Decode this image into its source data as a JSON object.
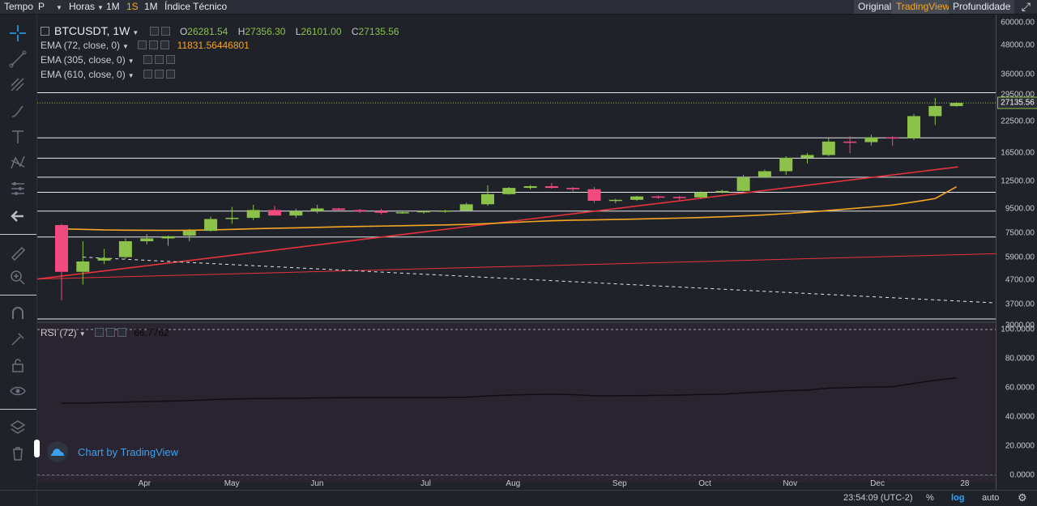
{
  "toolbar": {
    "tempo": "Tempo",
    "period": "P",
    "horas": "Horas",
    "tf_1m_a": "1M",
    "tf_1s": "1S",
    "tf_1m_b": "1M",
    "indicator": "Índice Técnico"
  },
  "views": {
    "original": "Original",
    "tradingview": "TradingView",
    "depth": "Profundidade"
  },
  "legend": {
    "symbol": "BTCUSDT, 1W",
    "o_label": "O",
    "o_value": "26281.54",
    "h_label": "H",
    "h_value": "27356.30",
    "l_label": "L",
    "l_value": "26101.00",
    "c_label": "C",
    "c_value": "27135.56",
    "ema1": "EMA (72, close, 0)",
    "ema1_value": "11831.56446801",
    "ema2": "EMA (305, close, 0)",
    "ema3": "EMA (610, close, 0)",
    "rsi": "RSI (72)",
    "rsi_value": "66.7762"
  },
  "price_axis": [
    "60000.00",
    "48000.00",
    "36000.00",
    "29500.00",
    "22500.00",
    "16500.00",
    "12500.00",
    "9500.00",
    "7500.00",
    "5900.00",
    "4700.00",
    "3700.00",
    "3000.00"
  ],
  "last_price": "27135.56",
  "rsi_axis": [
    "100.0000",
    "80.0000",
    "60.0000",
    "40.0000",
    "20.0000",
    "0.0000"
  ],
  "time_axis": [
    "Apr",
    "May",
    "Jun",
    "Jul",
    "Aug",
    "Sep",
    "Oct",
    "Nov",
    "Dec",
    "28"
  ],
  "status": {
    "time": "23:54:09 (UTC-2)",
    "percent": "%",
    "log": "log",
    "auto": "auto"
  },
  "watermark": "Chart by TradingView",
  "colors": {
    "up": "#8cc14a",
    "down": "#f04a7f",
    "ema_orange": "#f5a623",
    "accent": "#2aa6ff",
    "trend_red": "#e8323c"
  },
  "chart_data": {
    "type": "candlestick",
    "scale": "log",
    "ylim": [
      3000,
      60000
    ],
    "candles": [
      {
        "o": 8100,
        "h": 8200,
        "l": 3850,
        "c": 5100
      },
      {
        "o": 5100,
        "h": 6900,
        "l": 4500,
        "c": 5650
      },
      {
        "o": 5700,
        "h": 6400,
        "l": 5500,
        "c": 5850
      },
      {
        "o": 5900,
        "h": 7100,
        "l": 5800,
        "c": 6900
      },
      {
        "o": 6900,
        "h": 7400,
        "l": 6700,
        "c": 7100
      },
      {
        "o": 7100,
        "h": 7300,
        "l": 6600,
        "c": 7250
      },
      {
        "o": 7300,
        "h": 7800,
        "l": 6900,
        "c": 7650
      },
      {
        "o": 7650,
        "h": 8800,
        "l": 7600,
        "c": 8600
      },
      {
        "o": 8600,
        "h": 9700,
        "l": 8200,
        "c": 8700
      },
      {
        "o": 8700,
        "h": 9900,
        "l": 8500,
        "c": 9400
      },
      {
        "o": 9400,
        "h": 9800,
        "l": 8900,
        "c": 8900
      },
      {
        "o": 8900,
        "h": 9500,
        "l": 8700,
        "c": 9300
      },
      {
        "o": 9300,
        "h": 9900,
        "l": 9100,
        "c": 9550
      },
      {
        "o": 9550,
        "h": 9600,
        "l": 9300,
        "c": 9400
      },
      {
        "o": 9400,
        "h": 9500,
        "l": 9150,
        "c": 9300
      },
      {
        "o": 9300,
        "h": 9500,
        "l": 9000,
        "c": 9150
      },
      {
        "o": 9150,
        "h": 9300,
        "l": 9050,
        "c": 9200
      },
      {
        "o": 9200,
        "h": 9300,
        "l": 9050,
        "c": 9300
      },
      {
        "o": 9300,
        "h": 9400,
        "l": 9150,
        "c": 9350
      },
      {
        "o": 9350,
        "h": 10100,
        "l": 9300,
        "c": 9950
      },
      {
        "o": 9950,
        "h": 12000,
        "l": 9800,
        "c": 11000
      },
      {
        "o": 11000,
        "h": 11800,
        "l": 10950,
        "c": 11700
      },
      {
        "o": 11700,
        "h": 12050,
        "l": 11500,
        "c": 11900
      },
      {
        "o": 11900,
        "h": 12300,
        "l": 11600,
        "c": 11700
      },
      {
        "o": 11700,
        "h": 11800,
        "l": 11300,
        "c": 11550
      },
      {
        "o": 11550,
        "h": 11800,
        "l": 10100,
        "c": 10300
      },
      {
        "o": 10300,
        "h": 10500,
        "l": 10050,
        "c": 10400
      },
      {
        "o": 10400,
        "h": 10800,
        "l": 10300,
        "c": 10750
      },
      {
        "o": 10750,
        "h": 10850,
        "l": 10500,
        "c": 10700
      },
      {
        "o": 10700,
        "h": 10800,
        "l": 10400,
        "c": 10650
      },
      {
        "o": 10650,
        "h": 11300,
        "l": 10500,
        "c": 11200
      },
      {
        "o": 11200,
        "h": 11500,
        "l": 11100,
        "c": 11350
      },
      {
        "o": 11350,
        "h": 13300,
        "l": 11300,
        "c": 13000
      },
      {
        "o": 13000,
        "h": 14000,
        "l": 12900,
        "c": 13800
      },
      {
        "o": 13800,
        "h": 16000,
        "l": 13300,
        "c": 15750
      },
      {
        "o": 15750,
        "h": 16500,
        "l": 14900,
        "c": 16200
      },
      {
        "o": 16200,
        "h": 19200,
        "l": 16000,
        "c": 18500
      },
      {
        "o": 18500,
        "h": 19500,
        "l": 16500,
        "c": 18400
      },
      {
        "o": 18400,
        "h": 19800,
        "l": 17800,
        "c": 19300
      },
      {
        "o": 19300,
        "h": 19500,
        "l": 17700,
        "c": 19100
      },
      {
        "o": 19100,
        "h": 24300,
        "l": 18800,
        "c": 23800
      },
      {
        "o": 23800,
        "h": 28500,
        "l": 21800,
        "c": 26300
      },
      {
        "o": 26281.54,
        "h": 27356.3,
        "l": 26101,
        "c": 27135.56
      }
    ],
    "ema72": [
      7800,
      7760,
      7720,
      7700,
      7690,
      7685,
      7690,
      7720,
      7760,
      7810,
      7850,
      7880,
      7920,
      7960,
      7990,
      8020,
      8050,
      8080,
      8110,
      8150,
      8220,
      8300,
      8380,
      8450,
      8500,
      8530,
      8560,
      8600,
      8640,
      8680,
      8730,
      8790,
      8870,
      8960,
      9070,
      9200,
      9360,
      9520,
      9690,
      9870,
      10180,
      10530,
      11830
    ],
    "horizontal_levels": [
      30000,
      19200,
      15700,
      13000,
      11200,
      9300,
      7200,
      3200
    ],
    "rsi": [
      49.5,
      49.5,
      49.8,
      50.2,
      50.6,
      50.9,
      51.2,
      51.9,
      52.3,
      52.6,
      52.7,
      52.8,
      53.1,
      53.2,
      53.3,
      53.4,
      53.3,
      53.3,
      53.4,
      53.6,
      54.4,
      55.0,
      55.4,
      55.6,
      55.3,
      54.5,
      54.5,
      54.6,
      54.8,
      55.0,
      55.4,
      55.6,
      56.5,
      57.2,
      58.0,
      58.4,
      59.8,
      60.2,
      60.6,
      60.7,
      63.0,
      65.2,
      66.78
    ],
    "rsi_ylim": [
      0,
      100
    ]
  }
}
